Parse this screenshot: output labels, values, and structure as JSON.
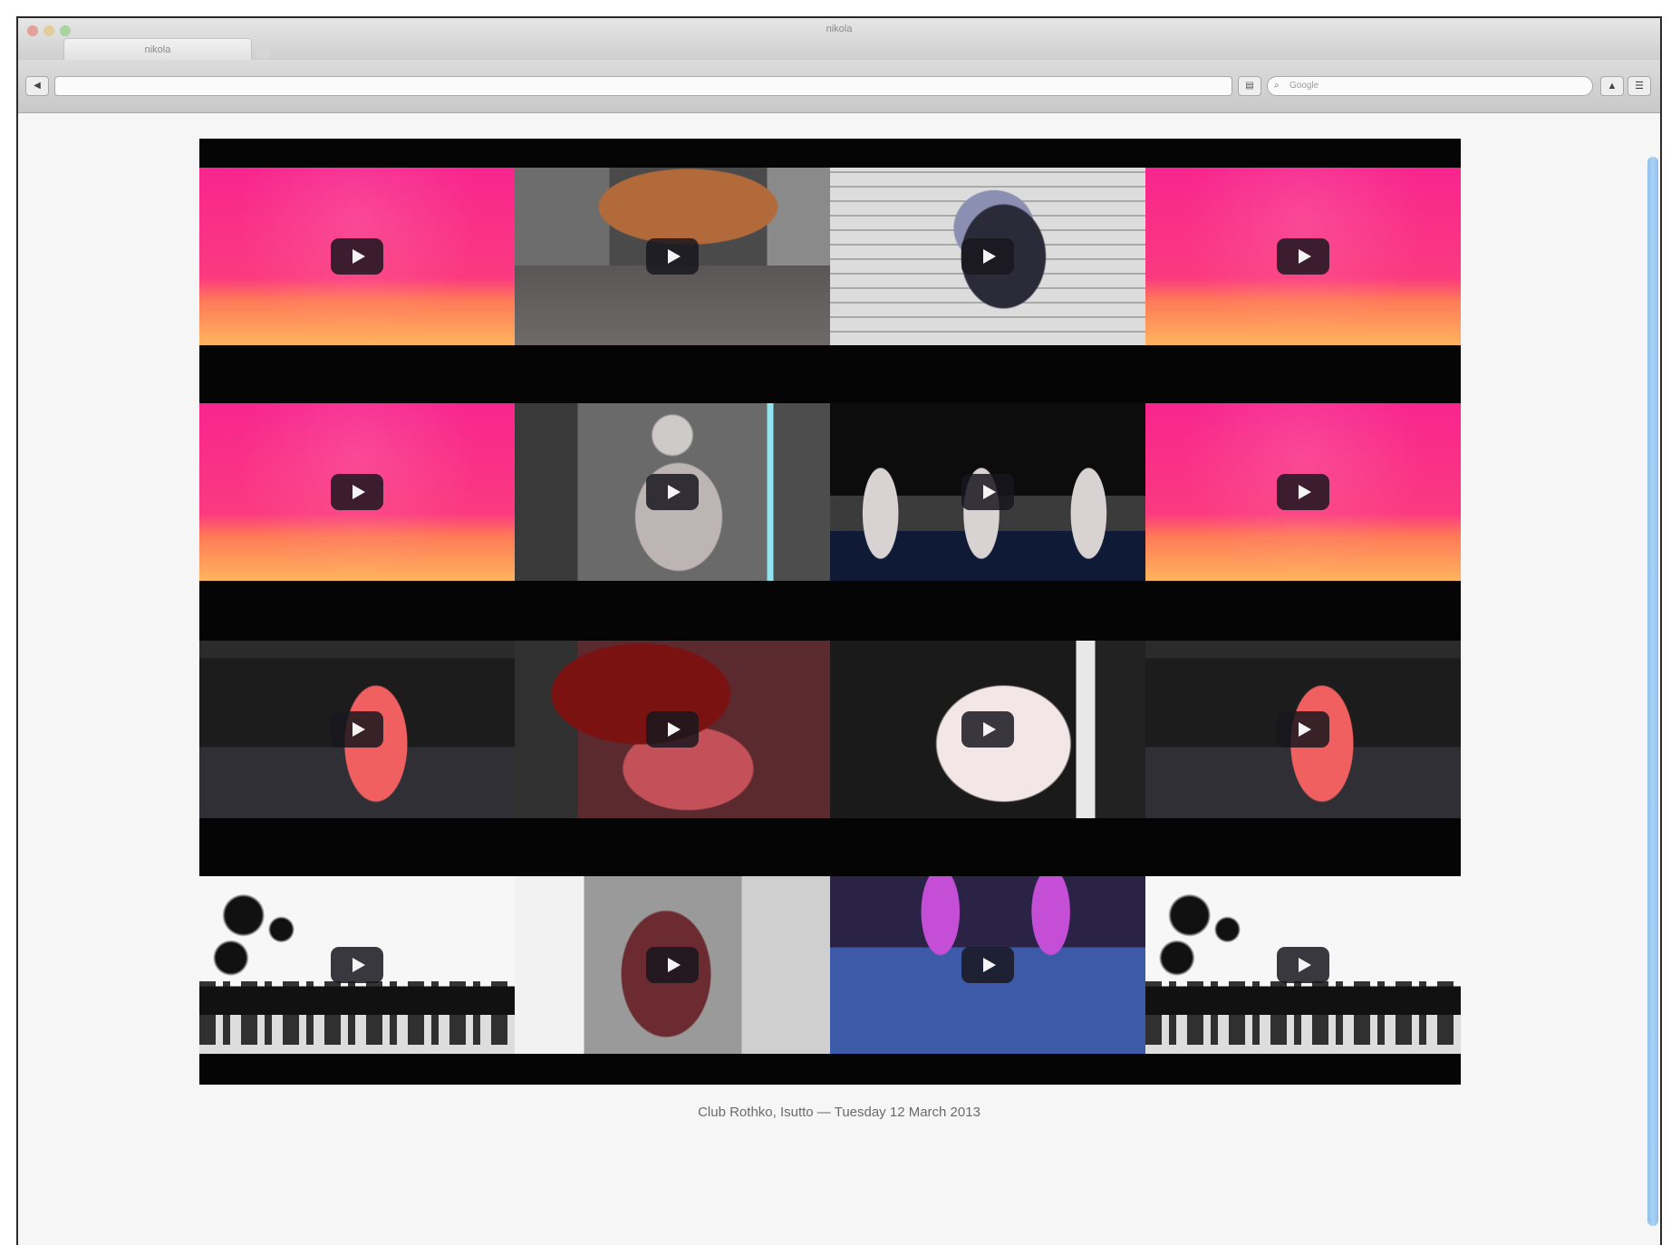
{
  "browser": {
    "window_title": "nikola",
    "tab_title": "nikola",
    "address": "",
    "search_placeholder": "Google"
  },
  "icons": {
    "back": "triangle-left",
    "reader": "reader-icon",
    "search": "search-icon",
    "share": "share-icon",
    "menu": "menu-icon"
  },
  "videos": {
    "rows": [
      [
        "pink-frame",
        "room-scene",
        "brick-wall-figure",
        "pink-frame"
      ],
      [
        "pink-frame",
        "grey-figure",
        "stage-figures",
        "pink-frame"
      ],
      [
        "club-red-figure",
        "dancer-closeup",
        "white-figure",
        "club-red-figure"
      ],
      [
        "graphic-poster",
        "dark-figure",
        "blue-club",
        "graphic-poster"
      ]
    ]
  },
  "caption": "Club Rothko, Isutto — Tuesday 12 March 2013"
}
